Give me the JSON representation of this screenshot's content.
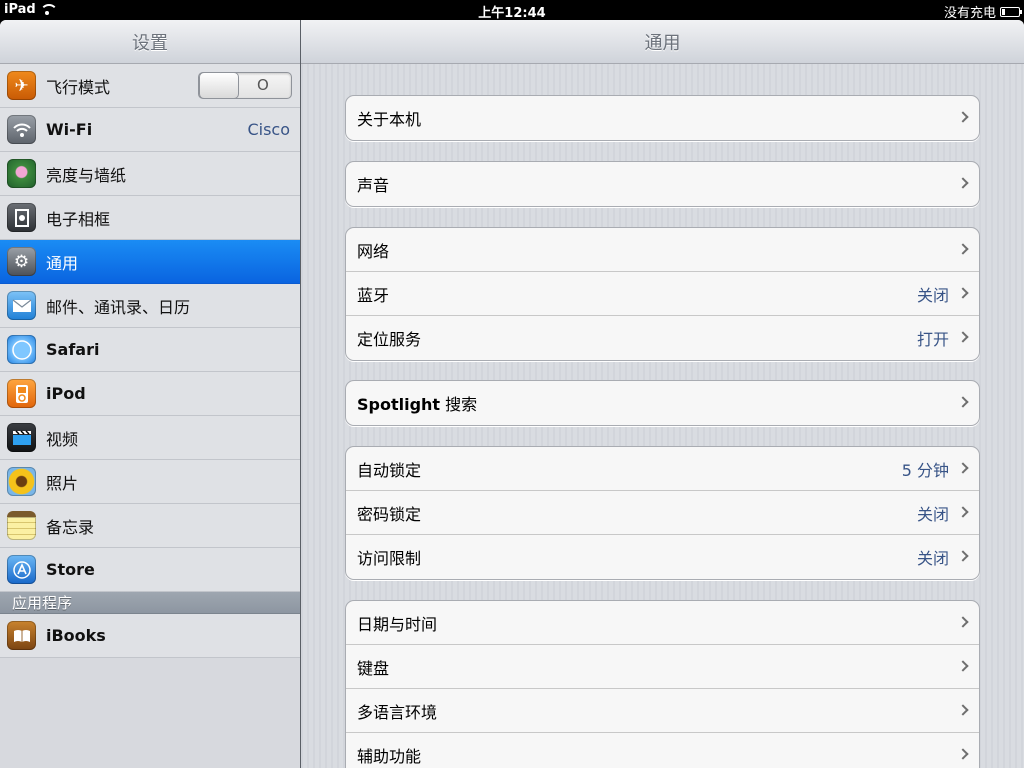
{
  "status_bar": {
    "device": "iPad",
    "time": "上午12:44",
    "charge_status": "没有充电"
  },
  "master": {
    "title": "设置",
    "items": [
      {
        "label": "飞行模式",
        "icon": "airplane-icon",
        "toggle": "O"
      },
      {
        "label": "Wi-Fi",
        "icon": "wifi-icon",
        "value": "Cisco"
      },
      {
        "label": "亮度与墙纸",
        "icon": "flower-wallpaper-icon"
      },
      {
        "label": "电子相框",
        "icon": "picture-frame-icon"
      },
      {
        "label": "通用",
        "icon": "gear-icon",
        "selected": true
      },
      {
        "label": "邮件、通讯录、日历",
        "icon": "mail-icon"
      },
      {
        "label": "Safari",
        "icon": "safari-compass-icon"
      },
      {
        "label": "iPod",
        "icon": "ipod-icon"
      },
      {
        "label": "视频",
        "icon": "video-clapper-icon"
      },
      {
        "label": "照片",
        "icon": "sunflower-photos-icon"
      },
      {
        "label": "备忘录",
        "icon": "notes-icon"
      },
      {
        "label": "Store",
        "icon": "app-store-icon"
      }
    ],
    "apps_section": {
      "header": "应用程序",
      "items": [
        {
          "label": "iBooks",
          "icon": "ibooks-icon"
        }
      ]
    }
  },
  "detail": {
    "title": "通用",
    "groups": [
      {
        "cells": [
          {
            "label": "关于本机"
          }
        ]
      },
      {
        "cells": [
          {
            "label": "声音"
          }
        ]
      },
      {
        "cells": [
          {
            "label": "网络"
          },
          {
            "label": "蓝牙",
            "value": "关闭"
          },
          {
            "label": "定位服务",
            "value": "打开"
          }
        ]
      },
      {
        "cells": [
          {
            "label_bold": "Spotlight",
            "label": " 搜索"
          }
        ]
      },
      {
        "cells": [
          {
            "label": "自动锁定",
            "value": "5 分钟"
          },
          {
            "label": "密码锁定",
            "value": "关闭"
          },
          {
            "label": "访问限制",
            "value": "关闭"
          }
        ]
      },
      {
        "cells": [
          {
            "label": "日期与时间"
          },
          {
            "label": "键盘"
          },
          {
            "label": "多语言环境"
          },
          {
            "label": "辅助功能"
          }
        ]
      }
    ]
  },
  "colors": {
    "selection_blue": "#0a64e0",
    "value_blue": "#385487",
    "group_bg": "#f7f7f7"
  }
}
